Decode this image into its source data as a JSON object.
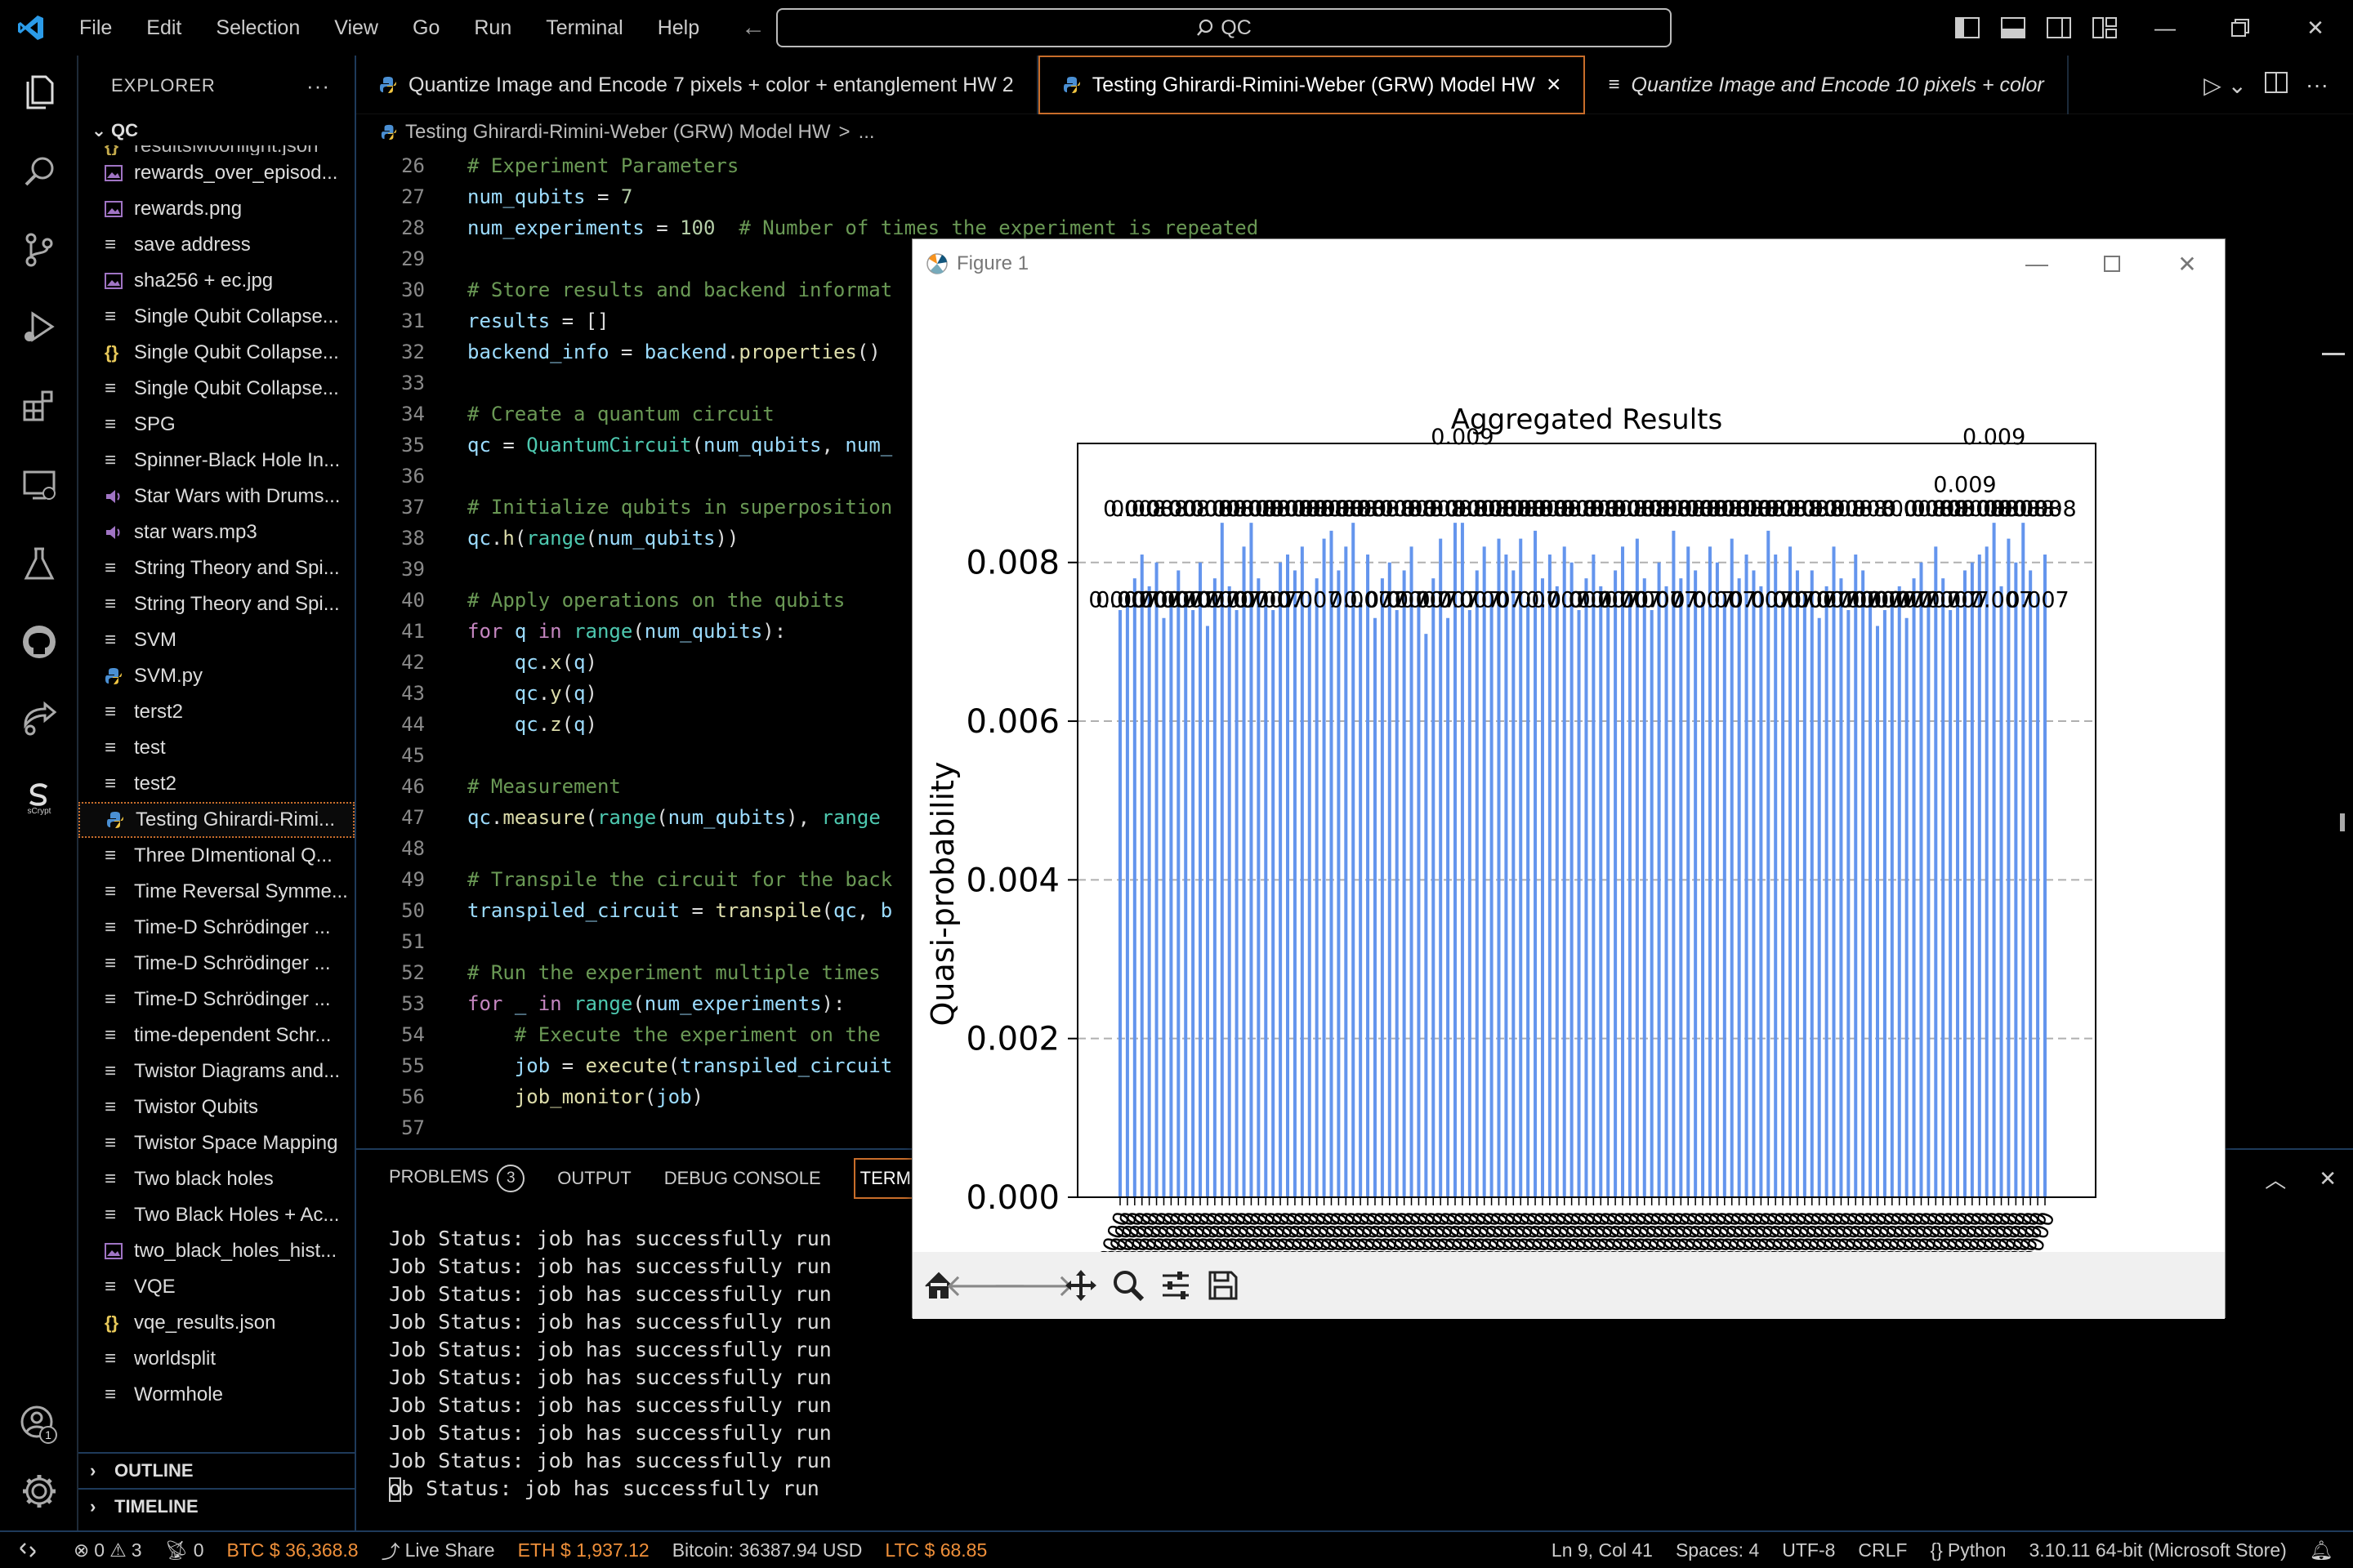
{
  "menu": [
    "File",
    "Edit",
    "Selection",
    "View",
    "Go",
    "Run",
    "Terminal",
    "Help"
  ],
  "search": {
    "text": "QC"
  },
  "explorer": {
    "title": "EXPLORER",
    "more": "···",
    "root": "QC",
    "partial_top": "resultsMoonlight.json",
    "files": [
      {
        "name": "rewards_over_episod...",
        "icon": "image-file-icon"
      },
      {
        "name": "rewards.png",
        "icon": "image-file-icon"
      },
      {
        "name": "save address",
        "icon": "text-file-icon"
      },
      {
        "name": "sha256 + ec.jpg",
        "icon": "image-file-icon"
      },
      {
        "name": "Single Qubit Collapse...",
        "icon": "text-file-icon"
      },
      {
        "name": "Single Qubit Collapse...",
        "icon": "json-file-icon"
      },
      {
        "name": "Single Qubit Collapse...",
        "icon": "text-file-icon"
      },
      {
        "name": "SPG",
        "icon": "text-file-icon"
      },
      {
        "name": "Spinner-Black Hole In...",
        "icon": "text-file-icon"
      },
      {
        "name": "Star Wars with Drums...",
        "icon": "audio-file-icon"
      },
      {
        "name": "star wars.mp3",
        "icon": "audio-file-icon"
      },
      {
        "name": "String Theory and Spi...",
        "icon": "text-file-icon"
      },
      {
        "name": "String Theory and Spi...",
        "icon": "text-file-icon"
      },
      {
        "name": "SVM",
        "icon": "text-file-icon"
      },
      {
        "name": "SVM.py",
        "icon": "python-file-icon"
      },
      {
        "name": "terst2",
        "icon": "text-file-icon"
      },
      {
        "name": "test",
        "icon": "text-file-icon"
      },
      {
        "name": "test2",
        "icon": "text-file-icon"
      },
      {
        "name": "Testing Ghirardi-Rimi...",
        "icon": "python-file-icon",
        "selected": true
      },
      {
        "name": "Three DImentional Q...",
        "icon": "text-file-icon"
      },
      {
        "name": "Time Reversal Symme...",
        "icon": "text-file-icon"
      },
      {
        "name": "Time-D Schrödinger ...",
        "icon": "text-file-icon"
      },
      {
        "name": "Time-D Schrödinger ...",
        "icon": "text-file-icon"
      },
      {
        "name": "Time-D Schrödinger ...",
        "icon": "text-file-icon"
      },
      {
        "name": "time-dependent Schr...",
        "icon": "text-file-icon"
      },
      {
        "name": "Twistor Diagrams and...",
        "icon": "text-file-icon"
      },
      {
        "name": "Twistor Qubits",
        "icon": "text-file-icon"
      },
      {
        "name": "Twistor Space Mapping",
        "icon": "text-file-icon"
      },
      {
        "name": "Two black holes",
        "icon": "text-file-icon"
      },
      {
        "name": "Two Black Holes + Ac...",
        "icon": "text-file-icon"
      },
      {
        "name": "two_black_holes_hist...",
        "icon": "image-file-icon"
      },
      {
        "name": "VQE",
        "icon": "text-file-icon"
      },
      {
        "name": "vqe_results.json",
        "icon": "json-file-icon"
      },
      {
        "name": "worldsplit",
        "icon": "text-file-icon"
      },
      {
        "name": "Wormhole",
        "icon": "text-file-icon"
      }
    ],
    "outline": "OUTLINE",
    "timeline": "TIMELINE"
  },
  "tabs": [
    {
      "label": "Quantize Image and Encode 7 pixels + color + entanglement HW 2",
      "italic": false
    },
    {
      "label": "Testing Ghirardi-Rimini-Weber (GRW) Model HW",
      "italic": false,
      "active": true,
      "close": "×"
    },
    {
      "label": "Quantize Image and Encode 10 pixels + color",
      "italic": true
    }
  ],
  "breadcrumb": {
    "file": "Testing Ghirardi-Rimini-Weber (GRW) Model HW",
    "sep": ">",
    "rest": "..."
  },
  "code_lines": [
    {
      "n": "26",
      "html": "<span class='cm'># Experiment Parameters</span>"
    },
    {
      "n": "27",
      "html": "<span class='vr'>num_qubits</span> = <span class='nm'>7</span>"
    },
    {
      "n": "28",
      "html": "<span class='vr'>num_experiments</span> = <span class='nm'>100</span>  <span class='cm'># Number of times the experiment is repeated</span>"
    },
    {
      "n": "29",
      "html": ""
    },
    {
      "n": "30",
      "html": "<span class='cm'># Store results and backend informat</span>"
    },
    {
      "n": "31",
      "html": "<span class='vr'>results</span> = []"
    },
    {
      "n": "32",
      "html": "<span class='vr'>backend_info</span> = <span class='vr'>backend</span>.<span class='fn'>properties</span>()"
    },
    {
      "n": "33",
      "html": ""
    },
    {
      "n": "34",
      "html": "<span class='cm'># Create a quantum circuit</span>"
    },
    {
      "n": "35",
      "html": "<span class='vr'>qc</span> = <span class='cls'>QuantumCircuit</span>(<span class='vr'>num_qubits</span>, <span class='vr'>num_</span>"
    },
    {
      "n": "36",
      "html": ""
    },
    {
      "n": "37",
      "html": "<span class='cm'># Initialize qubits in superposition</span>"
    },
    {
      "n": "38",
      "html": "<span class='vr'>qc</span>.<span class='fn'>h</span>(<span class='cls'>range</span>(<span class='vr'>num_qubits</span>))"
    },
    {
      "n": "39",
      "html": ""
    },
    {
      "n": "40",
      "html": "<span class='cm'># Apply operations on the qubits</span>"
    },
    {
      "n": "41",
      "html": "<span class='kw'>for</span> <span class='vr'>q</span> <span class='kw'>in</span> <span class='cls'>range</span>(<span class='vr'>num_qubits</span>):"
    },
    {
      "n": "42",
      "html": "    <span class='vr'>qc</span>.<span class='fn'>x</span>(<span class='vr'>q</span>)"
    },
    {
      "n": "43",
      "html": "    <span class='vr'>qc</span>.<span class='fn'>y</span>(<span class='vr'>q</span>)"
    },
    {
      "n": "44",
      "html": "    <span class='vr'>qc</span>.<span class='fn'>z</span>(<span class='vr'>q</span>)"
    },
    {
      "n": "45",
      "html": ""
    },
    {
      "n": "46",
      "html": "<span class='cm'># Measurement</span>"
    },
    {
      "n": "47",
      "html": "<span class='vr'>qc</span>.<span class='fn'>measure</span>(<span class='cls'>range</span>(<span class='vr'>num_qubits</span>), <span class='cls'>range</span>"
    },
    {
      "n": "48",
      "html": ""
    },
    {
      "n": "49",
      "html": "<span class='cm'># Transpile the circuit for the back</span>"
    },
    {
      "n": "50",
      "html": "<span class='vr'>transpiled_circuit</span> = <span class='fn'>transpile</span>(<span class='vr'>qc</span>, <span class='vr'>b</span>"
    },
    {
      "n": "51",
      "html": ""
    },
    {
      "n": "52",
      "html": "<span class='cm'># Run the experiment multiple times</span>"
    },
    {
      "n": "53",
      "html": "<span class='kw'>for</span> <span class='vr'>_</span> <span class='kw'>in</span> <span class='cls'>range</span>(<span class='vr'>num_experiments</span>):"
    },
    {
      "n": "54",
      "html": "    <span class='cm'># Execute the experiment on the</span>"
    },
    {
      "n": "55",
      "html": "    <span class='vr'>job</span> = <span class='fn'>execute</span>(<span class='vr'>transpiled_circuit</span>"
    },
    {
      "n": "56",
      "html": "    <span class='fn'>job_monitor</span>(<span class='vr'>job</span>)"
    },
    {
      "n": "57",
      "html": ""
    }
  ],
  "panel": {
    "tabs": [
      "PROBLEMS",
      "OUTPUT",
      "DEBUG CONSOLE",
      "TERMINAL"
    ],
    "problems_count": "3",
    "terminal_lines": [
      "Job Status: job has successfully run",
      "Job Status: job has successfully run",
      "Job Status: job has successfully run",
      "Job Status: job has successfully run",
      "Job Status: job has successfully run",
      "Job Status: job has successfully run",
      "Job Status: job has successfully run",
      "Job Status: job has successfully run",
      "Job Status: job has successfully run"
    ],
    "last_line": "ob Status: job has successfully run"
  },
  "statusbar": {
    "errors": "0",
    "warnings": "3",
    "ports": "0",
    "btc": "BTC $ 36,368.8",
    "liveshare": "Live Share",
    "eth": "ETH $ 1,937.12",
    "bitcoin": "Bitcoin: 36387.94 USD",
    "ltc": "LTC $ 68.85",
    "position": "Ln 9, Col 41",
    "spaces": "Spaces: 4",
    "encoding": "UTF-8",
    "eol": "CRLF",
    "language": "Python",
    "interpreter": "3.10.11 64-bit (Microsoft Store)",
    "account_badge": "1"
  },
  "figure": {
    "title": "Figure 1"
  },
  "chart_data": {
    "type": "bar",
    "title": "Aggregated Results",
    "ylabel": "Quasi-probability",
    "xlabel": "",
    "ylim": [
      0,
      0.0095
    ],
    "yticks": [
      "0.000",
      "0.002",
      "0.004",
      "0.006",
      "0.008"
    ],
    "ytick_values": [
      0,
      0.002,
      0.004,
      0.006,
      0.008
    ],
    "grid": "horizontal dashed",
    "bar_color": "#6495ed",
    "values": [
      0.0074,
      0.0076,
      0.0078,
      0.0081,
      0.0077,
      0.008,
      0.0073,
      0.0075,
      0.0079,
      0.0076,
      0.0074,
      0.008,
      0.0072,
      0.0078,
      0.0085,
      0.0077,
      0.0074,
      0.0082,
      0.0085,
      0.0078,
      0.0076,
      0.0074,
      0.008,
      0.0081,
      0.0079,
      0.0082,
      0.0076,
      0.0078,
      0.0083,
      0.0084,
      0.0079,
      0.0082,
      0.0085,
      0.0075,
      0.0081,
      0.0073,
      0.0078,
      0.008,
      0.0074,
      0.0079,
      0.0082,
      0.0076,
      0.0071,
      0.0078,
      0.0083,
      0.0073,
      0.0085,
      0.0085,
      0.0074,
      0.0079,
      0.0082,
      0.0076,
      0.0083,
      0.0081,
      0.0079,
      0.0083,
      0.0075,
      0.0084,
      0.0078,
      0.0081,
      0.0077,
      0.0082,
      0.008,
      0.0074,
      0.0078,
      0.0081,
      0.0077,
      0.0075,
      0.0079,
      0.0082,
      0.0076,
      0.0083,
      0.0078,
      0.0074,
      0.008,
      0.0077,
      0.0084,
      0.0078,
      0.0082,
      0.0079,
      0.0075,
      0.0082,
      0.008,
      0.0076,
      0.0083,
      0.0078,
      0.0081,
      0.0079,
      0.0077,
      0.0084,
      0.0081,
      0.0075,
      0.0082,
      0.0079,
      0.0076,
      0.0079,
      0.0073,
      0.0077,
      0.0082,
      0.0078,
      0.0074,
      0.0081,
      0.0079,
      0.0076,
      0.0072,
      0.0074,
      0.0075,
      0.0077,
      0.0073,
      0.0078,
      0.008,
      0.0075,
      0.0082,
      0.0078,
      0.0074,
      0.0076,
      0.0079,
      0.008,
      0.0081,
      0.0082,
      0.0085,
      0.0077,
      0.0083,
      0.008,
      0.0085,
      0.0079,
      0.0076,
      0.0081
    ],
    "bar_labels": {
      "top": [
        {
          "text": "0.009",
          "bar": 47
        },
        {
          "text": "0.009",
          "bar": 116
        },
        {
          "text": "0.009",
          "bar": 120
        }
      ],
      "high_row": "0.008",
      "low_row": "0.007"
    },
    "x_tick_label_pattern": "0000000"
  }
}
